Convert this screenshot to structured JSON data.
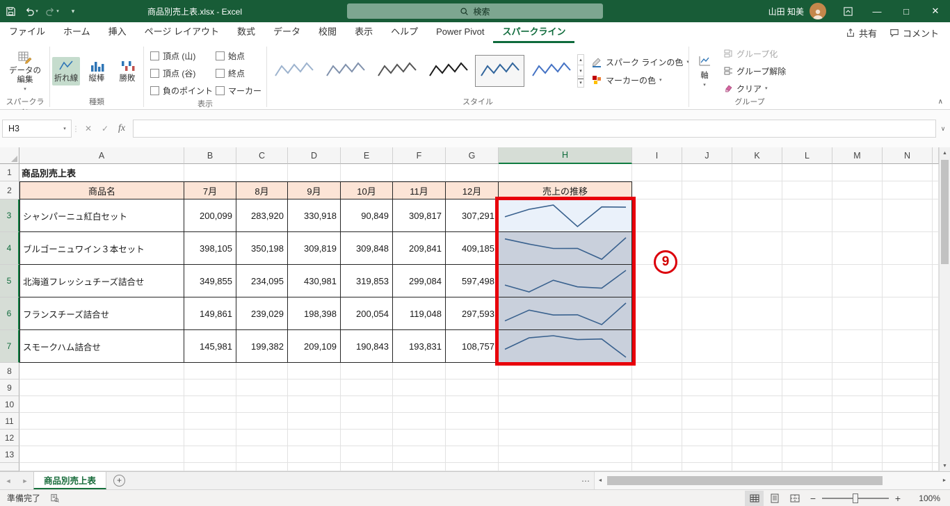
{
  "title_bar": {
    "full_title": "商品別売上表.xlsx - Excel",
    "search_placeholder": "検索",
    "user_name": "山田 知美"
  },
  "tab_row": {
    "tabs": [
      "ファイル",
      "ホーム",
      "挿入",
      "ページ レイアウト",
      "数式",
      "データ",
      "校閲",
      "表示",
      "ヘルプ",
      "Power Pivot",
      "スパークライン"
    ],
    "active_tab": "スパークライン",
    "share_label": "共有",
    "comment_label": "コメント"
  },
  "ribbon": {
    "edit_data_label": "データの編集",
    "labels": {
      "sparkline": "スパークライン",
      "type": "種類",
      "show": "表示",
      "style": "スタイル",
      "group": "グループ"
    },
    "type_buttons": [
      "折れ線",
      "縦棒",
      "勝敗"
    ],
    "selected_type": "折れ線",
    "show_checkboxes": [
      "頂点 (山)",
      "頂点 (谷)",
      "負のポイント",
      "始点",
      "終点",
      "マーカー"
    ],
    "style_gallery": {
      "colors": [
        "#9DB3CE",
        "#8091AC",
        "#555555",
        "#1A1A1A",
        "#31659C",
        "#4472C4"
      ],
      "selected_index": 4
    },
    "sparkline_color_label": "スパーク ラインの色",
    "marker_color_label": "マーカーの色",
    "axis_label": "軸",
    "group_label": "グループ化",
    "ungroup_label": "グループ解除",
    "clear_label": "クリア"
  },
  "formula_bar": {
    "name_box": "H3",
    "fx_label": "fx",
    "formula_value": ""
  },
  "sheet": {
    "columns": [
      "A",
      "B",
      "C",
      "D",
      "E",
      "F",
      "G",
      "H",
      "I",
      "J",
      "K",
      "L",
      "M",
      "N"
    ],
    "row_count": 13,
    "title_cell": "商品別売上表",
    "header_row": [
      "商品名",
      "7月",
      "8月",
      "9月",
      "10月",
      "11月",
      "12月",
      "売上の推移"
    ],
    "products": [
      {
        "name": "シャンパーニュ紅白セット",
        "values": [
          200099,
          283920,
          330918,
          90849,
          309817,
          307291
        ]
      },
      {
        "name": "ブルゴーニュワイン３本セット",
        "values": [
          398105,
          350198,
          309819,
          309848,
          209841,
          409185
        ]
      },
      {
        "name": "北海道フレッシュチーズ詰合せ",
        "values": [
          349855,
          234095,
          430981,
          319853,
          299084,
          597498
        ]
      },
      {
        "name": "フランスチーズ詰合せ",
        "values": [
          149861,
          239029,
          198398,
          200054,
          119048,
          297593
        ]
      },
      {
        "name": "スモークハム詰合せ",
        "values": [
          145981,
          199382,
          209109,
          190843,
          193831,
          108757
        ]
      }
    ],
    "selection": {
      "active_cell": "H3",
      "range": "H3:H7"
    },
    "selected_column": "H",
    "selected_rows": [
      3,
      4,
      5,
      6,
      7
    ],
    "sparkline_color": "#39618E"
  },
  "annotation": {
    "circle_label": "9",
    "color": "#E8000B"
  },
  "sheet_tabs": {
    "active_tab": "商品別売上表"
  },
  "status_bar": {
    "ready_label": "準備完了",
    "zoom_value": "100%"
  }
}
